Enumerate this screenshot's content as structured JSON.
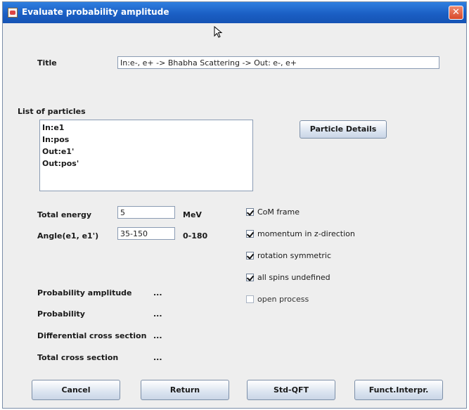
{
  "window": {
    "title": "Evaluate probability amplitude",
    "close_glyph": "✕"
  },
  "title_row": {
    "label": "Title",
    "value": "In:e-, e+ -> Bhabha Scattering -> Out: e-, e+"
  },
  "particles": {
    "label": "List of particles",
    "items": [
      "In:e1",
      "In:pos",
      "Out:e1'",
      "Out:pos'"
    ],
    "details_button": "Particle Details"
  },
  "energy": {
    "label": "Total energy",
    "value": "5",
    "unit": "MeV"
  },
  "angle": {
    "label": "Angle(e1, e1')",
    "value": "35-150",
    "range": "0-180"
  },
  "options": [
    {
      "label": "CoM frame",
      "checked": true
    },
    {
      "label": "momentum in z-direction",
      "checked": true
    },
    {
      "label": "rotation symmetric",
      "checked": true
    },
    {
      "label": "all spins undefined",
      "checked": true
    },
    {
      "label": "open process",
      "checked": false
    }
  ],
  "results": [
    {
      "label": "Probability amplitude",
      "value": "..."
    },
    {
      "label": "Probability",
      "value": "..."
    },
    {
      "label": "Differential cross section",
      "value": "..."
    },
    {
      "label": "Total cross section",
      "value": "..."
    }
  ],
  "buttons": {
    "cancel": "Cancel",
    "return": "Return",
    "std_qft": "Std-QFT",
    "funct_interpr": "Funct.Interpr."
  }
}
